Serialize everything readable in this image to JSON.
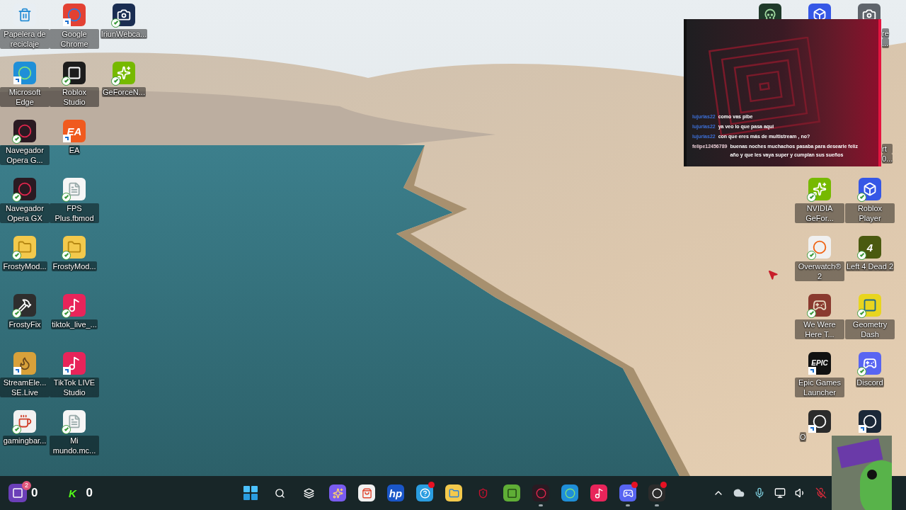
{
  "desktop_left": [
    {
      "label": "Papelera de reciclaje",
      "kind": "recycle",
      "shortcut": false,
      "synced": false
    },
    {
      "label": "Microsoft Edge",
      "kind": "edge",
      "shortcut": true,
      "synced": false
    },
    {
      "label": "Navegador Opera G...",
      "kind": "opera",
      "shortcut": false,
      "synced": true
    },
    {
      "label": "Navegador Opera GX",
      "kind": "opera",
      "shortcut": false,
      "synced": true
    },
    {
      "label": "FrostyMod...",
      "kind": "folder",
      "shortcut": false,
      "synced": true
    },
    {
      "label": "FrostyFix",
      "kind": "tool",
      "shortcut": false,
      "synced": true
    },
    {
      "label": "StreamEle... SE.Live",
      "kind": "stream",
      "shortcut": true,
      "synced": false
    },
    {
      "label": "gamingbar...",
      "kind": "java",
      "shortcut": false,
      "synced": true
    },
    {
      "label": "Google Chrome",
      "kind": "chrome",
      "shortcut": true,
      "synced": false
    },
    {
      "label": "Roblox Studio",
      "kind": "roblox",
      "shortcut": false,
      "synced": true
    },
    {
      "label": "EA",
      "kind": "ea",
      "glyph": "EA",
      "shortcut": true,
      "synced": false
    },
    {
      "label": "FPS Plus.fbmod",
      "kind": "file",
      "shortcut": false,
      "synced": true
    },
    {
      "label": "FrostyMod...",
      "kind": "folder",
      "shortcut": false,
      "synced": true
    },
    {
      "label": "tiktok_live_...",
      "kind": "tiktok",
      "shortcut": false,
      "synced": true
    },
    {
      "label": "TikTok LIVE Studio",
      "kind": "tiktok",
      "shortcut": true,
      "synced": false
    },
    {
      "label": "Mi mundo.mc...",
      "kind": "file",
      "shortcut": false,
      "synced": true
    },
    {
      "label": "IriunWebca...",
      "kind": "webcam",
      "shortcut": false,
      "synced": true
    },
    {
      "label": "GeForceN...",
      "kind": "nvidia",
      "shortcut": false,
      "synced": true
    }
  ],
  "desktop_right": [
    {
      "label": "NVIDIA GeFor...",
      "kind": "nvidia",
      "shortcut": false,
      "synced": true
    },
    {
      "label": "Overwatch® 2",
      "kind": "overwatch",
      "shortcut": false,
      "synced": true
    },
    {
      "label": "We Were Here T...",
      "kind": "wewere",
      "shortcut": false,
      "synced": true
    },
    {
      "label": "Epic Games Launcher",
      "kind": "epic",
      "glyph": "EPIC",
      "shortcut": true,
      "synced": false
    },
    {
      "kind": "obs",
      "shortcut": true,
      "synced": false
    },
    {
      "label": "Roblox Player",
      "kind": "robloxplayer",
      "shortcut": false,
      "synced": true
    },
    {
      "label": "Left 4 Dead 2",
      "kind": "l4d",
      "glyph": "4",
      "shortcut": false,
      "synced": true
    },
    {
      "label": "Geometry Dash",
      "kind": "geometry",
      "shortcut": false,
      "synced": true
    },
    {
      "label": "Discord",
      "kind": "discord",
      "shortcut": false,
      "synced": true
    },
    {
      "kind": "steam",
      "shortcut": true,
      "synced": false
    }
  ],
  "desktop_top_right": [
    {
      "kind": "zombie"
    },
    {
      "kind": "robloxplayer"
    },
    {
      "kind": "webcam2"
    }
  ],
  "cut_labels": [
    {
      "lines": [
        "re",
        "..."
      ]
    },
    {
      "lines": [
        "rt",
        "0..."
      ]
    },
    {
      "lines": [
        "O"
      ]
    }
  ],
  "chat": [
    {
      "user": "lujurias22",
      "color": "#3c6fd6",
      "text": "como vas pibe"
    },
    {
      "user": "lujurias22",
      "color": "#3c6fd6",
      "text": "ya veo lo que pasa aqui"
    },
    {
      "user": "lujurias22",
      "color": "#3c6fd6",
      "text": "con que eres más de multistream , no?"
    },
    {
      "user": "felipe12456789",
      "color": "#e9cdd6",
      "text": "buenas noches muchachos pasaba para desearle feliz año y que les vaya super y cumplan sus sueños"
    }
  ],
  "taskbar": {
    "widgets": [
      {
        "kind": "twitch",
        "badge": "2",
        "count": "0"
      },
      {
        "kind": "kick",
        "glyph": "K",
        "count": "0"
      }
    ],
    "apps": [
      {
        "kind": "start",
        "running": false,
        "notify": false
      },
      {
        "kind": "search",
        "running": false,
        "notify": false
      },
      {
        "kind": "taskview",
        "running": false,
        "notify": false
      },
      {
        "kind": "copilot",
        "running": false,
        "notify": false
      },
      {
        "kind": "store",
        "running": false,
        "notify": false
      },
      {
        "kind": "hp",
        "glyph": "hp",
        "running": false,
        "notify": false
      },
      {
        "kind": "help",
        "running": false,
        "notify": true
      },
      {
        "kind": "explorer",
        "running": false,
        "notify": false
      },
      {
        "kind": "mcafee",
        "running": false,
        "notify": false
      },
      {
        "kind": "minecraft",
        "running": false,
        "notify": false
      },
      {
        "kind": "opera",
        "running": true,
        "notify": false
      },
      {
        "kind": "edge",
        "running": false,
        "notify": false
      },
      {
        "kind": "tiktok",
        "running": false,
        "notify": false
      },
      {
        "kind": "discord",
        "running": true,
        "notify": true
      },
      {
        "kind": "obs",
        "running": true,
        "notify": true
      }
    ]
  }
}
